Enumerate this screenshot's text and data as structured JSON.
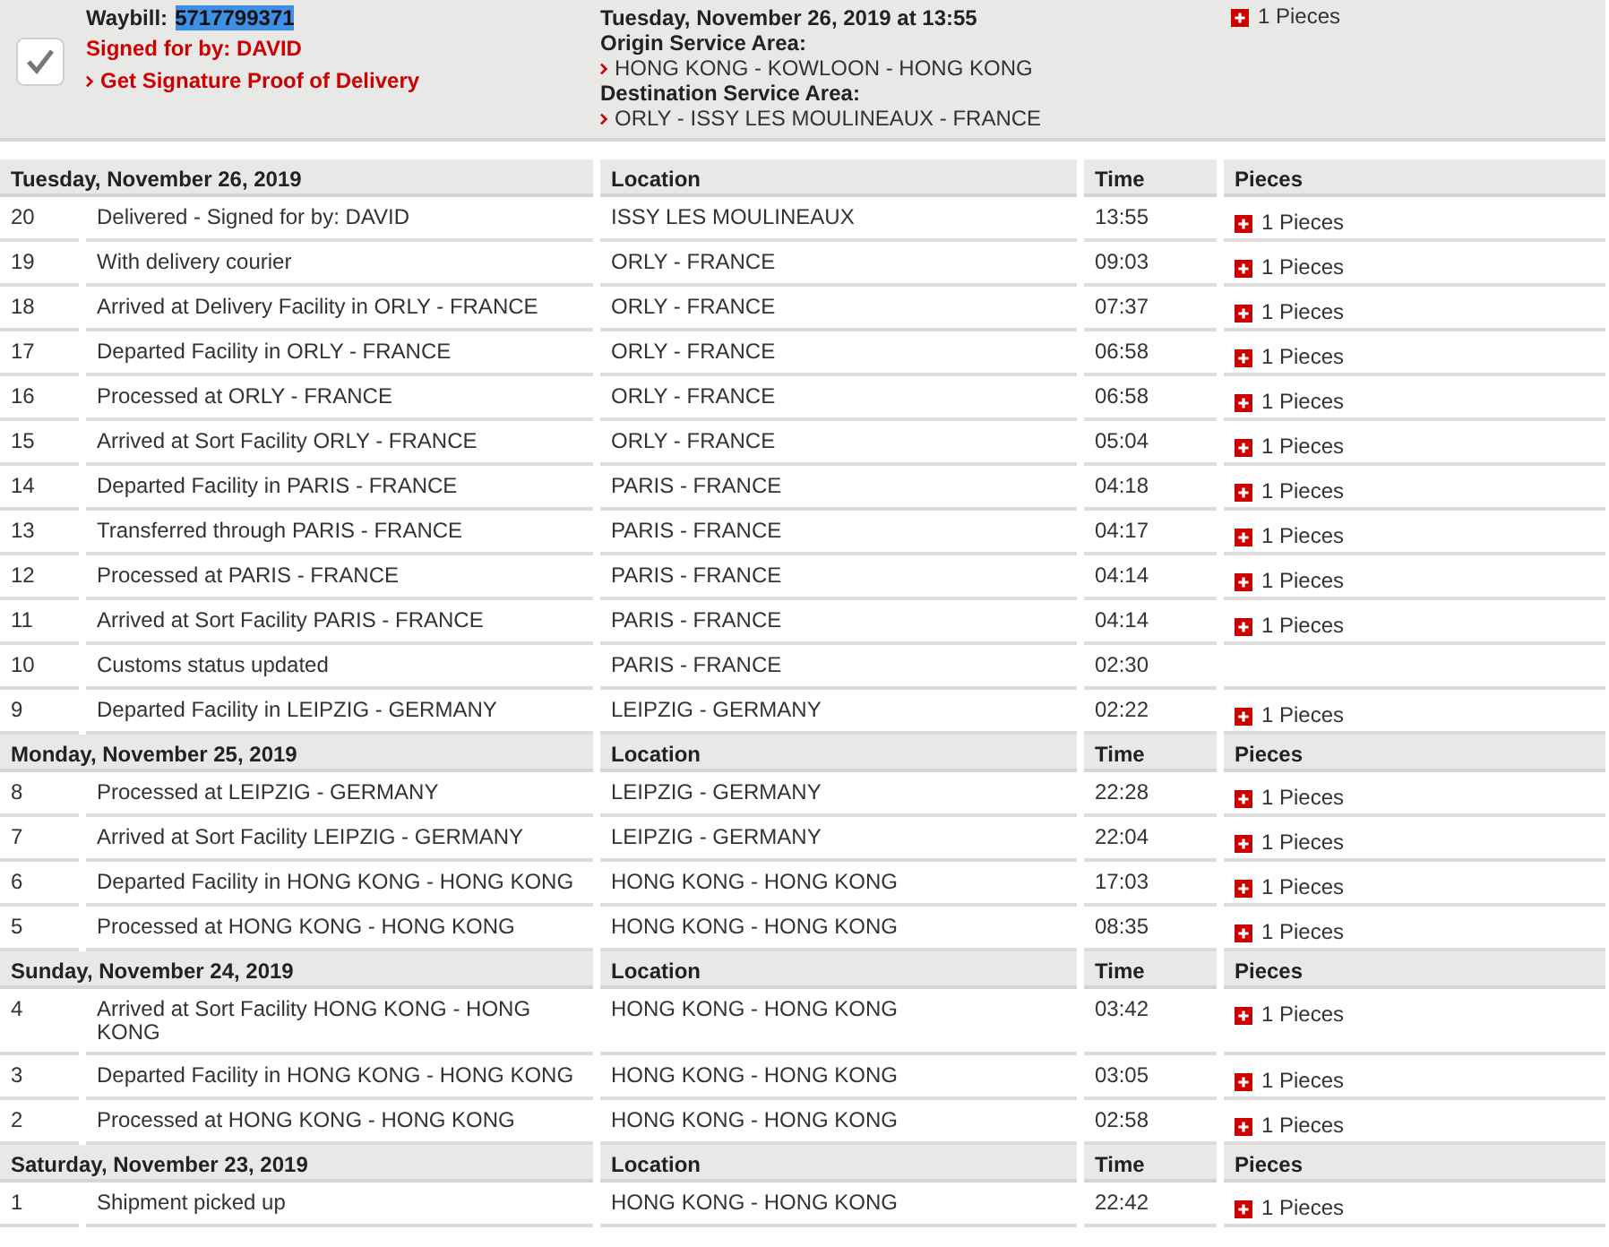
{
  "shipment": {
    "waybill_label": "Waybill:",
    "waybill_number": {
      "text": "5717799371",
      "selected": true
    },
    "status": "Signed for by: DAVID",
    "proof_link": "Get Signature Proof of Delivery",
    "delivered": "Tuesday, November 26, 2019 at 13:55",
    "origin_label": "Origin Service Area:",
    "origin": "HONG KONG - KOWLOON - HONG KONG",
    "destination_label": "Destination Service Area:",
    "destination": "ORLY - ISSY LES MOULINEAUX - FRANCE",
    "pieces": "1 Pieces"
  },
  "days": [
    {
      "date": "Tuesday, November 26, 2019",
      "columns": [
        "Location",
        "Time",
        "Pieces"
      ],
      "events": [
        {
          "number": "20",
          "description": "Delivered - Signed for by: DAVID",
          "location": "ISSY LES MOULINEAUX",
          "time": "13:55",
          "pieces": "1 Pieces"
        },
        {
          "number": "19",
          "description": "With delivery courier",
          "location": "ORLY - FRANCE",
          "time": "09:03",
          "pieces": "1 Pieces"
        },
        {
          "number": "18",
          "description": "Arrived at Delivery Facility in ORLY - FRANCE",
          "location": "ORLY - FRANCE",
          "time": "07:37",
          "pieces": "1 Pieces"
        },
        {
          "number": "17",
          "description": "Departed Facility in ORLY - FRANCE",
          "location": "ORLY - FRANCE",
          "time": "06:58",
          "pieces": "1 Pieces"
        },
        {
          "number": "16",
          "description": "Processed at ORLY - FRANCE",
          "location": "ORLY - FRANCE",
          "time": "06:58",
          "pieces": "1 Pieces"
        },
        {
          "number": "15",
          "description": "Arrived at Sort Facility ORLY - FRANCE",
          "location": "ORLY - FRANCE",
          "time": "05:04",
          "pieces": "1 Pieces"
        },
        {
          "number": "14",
          "description": "Departed Facility in PARIS - FRANCE",
          "location": "PARIS - FRANCE",
          "time": "04:18",
          "pieces": "1 Pieces"
        },
        {
          "number": "13",
          "description": "Transferred through PARIS - FRANCE",
          "location": "PARIS - FRANCE",
          "time": "04:17",
          "pieces": "1 Pieces"
        },
        {
          "number": "12",
          "description": "Processed at PARIS - FRANCE",
          "location": "PARIS - FRANCE",
          "time": "04:14",
          "pieces": "1 Pieces"
        },
        {
          "number": "11",
          "description": "Arrived at Sort Facility PARIS - FRANCE",
          "location": "PARIS - FRANCE",
          "time": "04:14",
          "pieces": "1 Pieces"
        },
        {
          "number": "10",
          "description": "Customs status updated",
          "location": "PARIS - FRANCE",
          "time": "02:30"
        },
        {
          "number": "9",
          "description": "Departed Facility in LEIPZIG - GERMANY",
          "location": "LEIPZIG - GERMANY",
          "time": "02:22",
          "pieces": "1 Pieces"
        }
      ]
    },
    {
      "date": "Monday, November 25, 2019",
      "columns": [
        "Location",
        "Time",
        "Pieces"
      ],
      "events": [
        {
          "number": "8",
          "description": "Processed at LEIPZIG - GERMANY",
          "location": "LEIPZIG - GERMANY",
          "time": "22:28",
          "pieces": "1 Pieces"
        },
        {
          "number": "7",
          "description": "Arrived at Sort Facility LEIPZIG - GERMANY",
          "location": "LEIPZIG - GERMANY",
          "time": "22:04",
          "pieces": "1 Pieces"
        },
        {
          "number": "6",
          "description": "Departed Facility in HONG KONG - HONG KONG",
          "location": "HONG KONG - HONG KONG",
          "time": "17:03",
          "pieces": "1 Pieces"
        },
        {
          "number": "5",
          "description": "Processed at HONG KONG - HONG KONG",
          "location": "HONG KONG - HONG KONG",
          "time": "08:35",
          "pieces": "1 Pieces"
        }
      ]
    },
    {
      "date": "Sunday, November 24, 2019",
      "columns": [
        "Location",
        "Time",
        "Pieces"
      ],
      "events": [
        {
          "number": "4",
          "description": "Arrived at Sort Facility HONG KONG - HONG KONG",
          "location": "HONG KONG - HONG KONG",
          "time": "03:42",
          "pieces": "1 Pieces"
        },
        {
          "number": "3",
          "description": "Departed Facility in HONG KONG - HONG KONG",
          "location": "HONG KONG - HONG KONG",
          "time": "03:05",
          "pieces": "1 Pieces"
        },
        {
          "number": "2",
          "description": "Processed at HONG KONG - HONG KONG",
          "location": "HONG KONG - HONG KONG",
          "time": "02:58",
          "pieces": "1 Pieces"
        }
      ]
    },
    {
      "date": "Saturday, November 23, 2019",
      "columns": [
        "Location",
        "Time",
        "Pieces"
      ],
      "events": [
        {
          "number": "1",
          "description": "Shipment picked up",
          "location": "HONG KONG - HONG KONG",
          "time": "22:42",
          "pieces": "1 Pieces"
        }
      ]
    }
  ]
}
